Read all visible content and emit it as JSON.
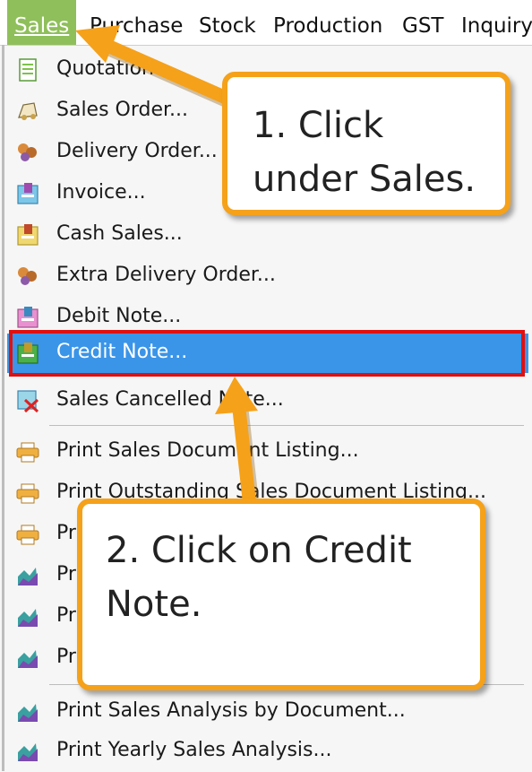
{
  "menubar": {
    "items": [
      {
        "label": "Sales"
      },
      {
        "label": "Purchase"
      },
      {
        "label": "Stock"
      },
      {
        "label": "Production"
      },
      {
        "label": "GST"
      },
      {
        "label": "Inquiry"
      }
    ]
  },
  "dropdown": {
    "items": [
      {
        "label": "Quotation..."
      },
      {
        "label": "Sales Order..."
      },
      {
        "label": "Delivery Order..."
      },
      {
        "label": "Invoice..."
      },
      {
        "label": "Cash Sales..."
      },
      {
        "label": "Extra Delivery Order..."
      },
      {
        "label": "Debit Note..."
      },
      {
        "label": "Credit Note..."
      },
      {
        "label": "Sales Cancelled Note..."
      },
      {
        "label": "Print Sales Document Listing..."
      },
      {
        "label": "Print Outstanding Sales Document Listing..."
      },
      {
        "label": "Pr"
      },
      {
        "label": "Pr"
      },
      {
        "label": "Pr"
      },
      {
        "label": "Pr"
      },
      {
        "label": "Print Sales Analysis by Document..."
      },
      {
        "label": "Print Yearly Sales Analysis..."
      }
    ]
  },
  "callouts": {
    "step1": {
      "line1": "1. Click",
      "line2": "under Sales."
    },
    "step2": {
      "line1": "2. Click on Credit",
      "line2": "Note."
    }
  },
  "colors": {
    "menu_active": "#8fbf5a",
    "selection": "#3a95e8",
    "highlight_border": "#e01010",
    "callout_border": "#f5a11a",
    "arrow": "#f5a11a"
  }
}
